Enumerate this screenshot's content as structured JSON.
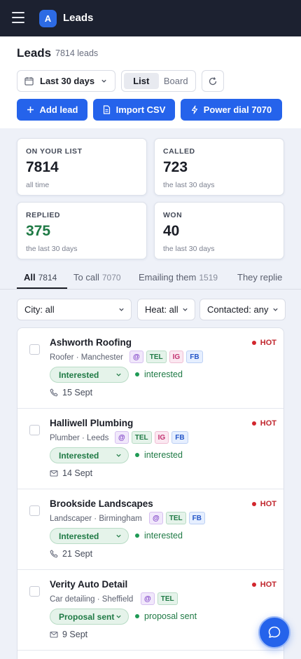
{
  "app": {
    "title": "Leads",
    "logo_letter": "A"
  },
  "header": {
    "title": "Leads",
    "count_text": "7814 leads",
    "date_range": "Last 30 days",
    "views": [
      "List",
      "Board"
    ],
    "active_view": "List",
    "actions": {
      "add_lead": "Add lead",
      "import_csv": "Import CSV",
      "power_dial": "Power dial 7070"
    }
  },
  "stats": [
    {
      "label": "ON YOUR LIST",
      "value": "7814",
      "sub": "all time"
    },
    {
      "label": "CALLED",
      "value": "723",
      "sub": "the last 30 days"
    },
    {
      "label": "REPLIED",
      "value": "375",
      "sub": "the last 30 days"
    },
    {
      "label": "WON",
      "value": "40",
      "sub": "the last 30 days"
    }
  ],
  "tabs": [
    {
      "label": "All",
      "count": "7814",
      "active": true
    },
    {
      "label": "To call",
      "count": "7070"
    },
    {
      "label": "Emailing them",
      "count": "1519"
    },
    {
      "label": "They replie",
      "count": ""
    }
  ],
  "filters": {
    "city": "City: all",
    "heat": "Heat: all",
    "contacted": "Contacted: any"
  },
  "leads": [
    {
      "name": "Ashworth Roofing",
      "meta": "Roofer · Manchester",
      "channels": [
        "@",
        "TEL",
        "IG",
        "FB"
      ],
      "heat": "HOT",
      "stage": "Interested",
      "status": "interested",
      "last_contact": "15 Sept",
      "contact_type": "phone"
    },
    {
      "name": "Halliwell Plumbing",
      "meta": "Plumber · Leeds",
      "channels": [
        "@",
        "TEL",
        "IG",
        "FB"
      ],
      "heat": "HOT",
      "stage": "Interested",
      "status": "interested",
      "last_contact": "14 Sept",
      "contact_type": "email"
    },
    {
      "name": "Brookside Landscapes",
      "meta": "Landscaper · Birmingham",
      "channels": [
        "@",
        "TEL",
        "FB"
      ],
      "heat": "HOT",
      "stage": "Interested",
      "status": "interested",
      "last_contact": "21 Sept",
      "contact_type": "phone"
    },
    {
      "name": "Verity Auto Detail",
      "meta": "Car detailing · Sheffield",
      "channels": [
        "@",
        "TEL"
      ],
      "heat": "HOT",
      "stage": "Proposal sent",
      "status": "proposal sent",
      "last_contact": "9 Sept",
      "contact_type": "email"
    }
  ],
  "colors": {
    "topbar": "#1c2130",
    "accent": "#2563eb",
    "hot": "#c0262d",
    "positive": "#1f7a45"
  }
}
